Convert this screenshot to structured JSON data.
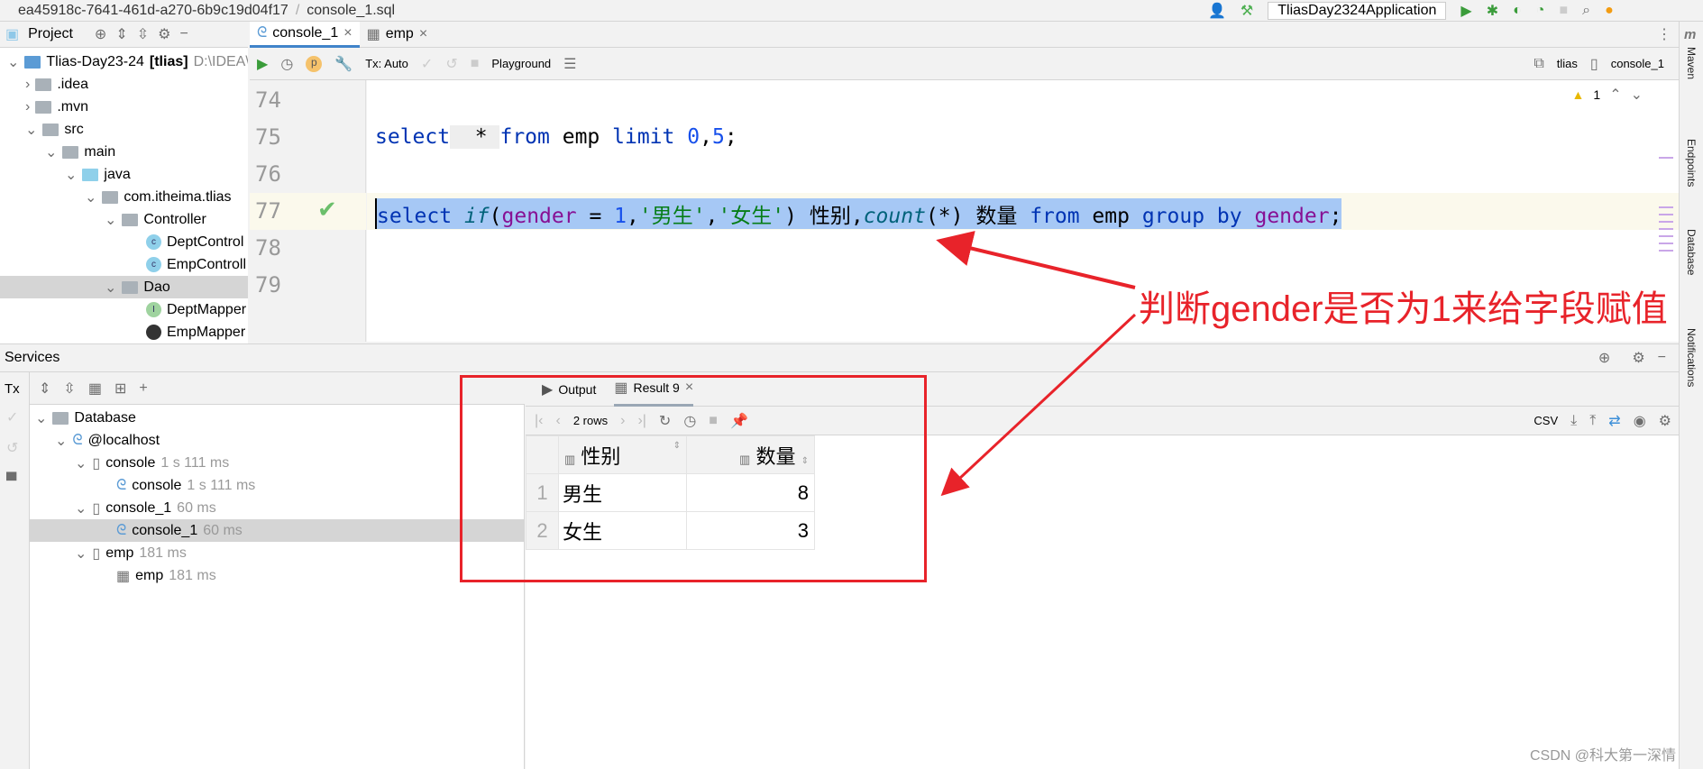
{
  "breadcrumb": {
    "path": "ea45918c-7641-461d-a270-6b9c19d04f17",
    "file": "console_1.sql"
  },
  "run_config": "TliasDay2324Application",
  "project": {
    "title": "Project",
    "root": "Tlias-Day23-24",
    "root_module": "[tlias]",
    "root_path": "D:\\IDEA\\i",
    "items": [
      ".idea",
      ".mvn",
      "src",
      "main",
      "java",
      "com.itheima.tlias",
      "Controller",
      "DeptControl",
      "EmpControll",
      "Dao",
      "DeptMapper",
      "EmpMapper"
    ]
  },
  "tabs": [
    {
      "label": "console_1"
    },
    {
      "label": "emp"
    }
  ],
  "editor_toolbar": {
    "tx": "Tx: Auto",
    "mode": "Playground",
    "schema": "tlias",
    "session": "console_1",
    "warnings": "1"
  },
  "editor": {
    "line_numbers": [
      "74",
      "75",
      "76",
      "77",
      "78",
      "79"
    ],
    "line75": [
      "select",
      "  * ",
      "from",
      " emp ",
      "limit",
      " ",
      "0",
      ",",
      "5",
      ";"
    ],
    "line77": [
      "select",
      " ",
      "if",
      "(",
      "gender",
      " = ",
      "1",
      ",",
      "'男生'",
      ",",
      "'女生'",
      ") 性别,",
      "count",
      "(*) 数量 ",
      "from",
      " emp ",
      "group by",
      " ",
      "gender",
      ";"
    ]
  },
  "annotation": "判断gender是否为1来给字段赋值",
  "services": {
    "title": "Services",
    "tx": "Tx",
    "tree": [
      {
        "label": "Database"
      },
      {
        "label": "@localhost"
      },
      {
        "label": "console",
        "time": "1 s 111 ms"
      },
      {
        "label": "console",
        "time": "1 s 111 ms"
      },
      {
        "label": "console_1",
        "time": "60 ms"
      },
      {
        "label": "console_1",
        "time": "60 ms"
      },
      {
        "label": "emp",
        "time": "181 ms"
      },
      {
        "label": "emp",
        "time": "181 ms"
      }
    ]
  },
  "results": {
    "tabs": [
      "Output",
      "Result 9"
    ],
    "rows_label": "2 rows",
    "export": "CSV",
    "columns": [
      "性别",
      "数量"
    ],
    "rows": [
      {
        "n": "1",
        "gender": "男生",
        "count": "8"
      },
      {
        "n": "2",
        "gender": "女生",
        "count": "3"
      }
    ]
  },
  "right_stripe": [
    "Maven",
    "Endpoints",
    "Database",
    "Notifications"
  ],
  "watermark": "CSDN @科大第一深情"
}
